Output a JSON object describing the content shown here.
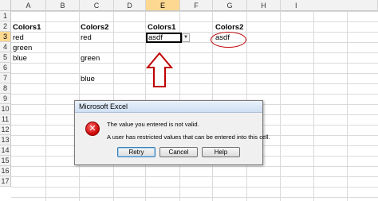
{
  "sheet": {
    "columns": [
      "A",
      "B",
      "C",
      "D",
      "E",
      "F",
      "G",
      "H",
      "I"
    ],
    "rows": [
      "1",
      "2",
      "3",
      "4",
      "5",
      "6",
      "7",
      "8",
      "9",
      "10",
      "11",
      "12",
      "13",
      "14",
      "15",
      "16",
      "17"
    ],
    "selected_column": "E",
    "selected_row": "3"
  },
  "cells": {
    "a2": "Colors1",
    "a3": "red",
    "a4": "green",
    "a5": "blue",
    "c2": "Colors2",
    "c3": "red",
    "c6": "green",
    "c8": "blue",
    "e2": "Colors1",
    "e3": "asdf",
    "g2": "Colors2",
    "g3": "asdf"
  },
  "dialog": {
    "title": "Microsoft Excel",
    "icon": "error-x-icon",
    "line1": "The value you entered is not valid.",
    "line2": "A user has restricted values that can be entered into this cell.",
    "buttons": {
      "retry": "Retry",
      "cancel": "Cancel",
      "help": "Help"
    }
  },
  "colors": {
    "selection_header": "#fcd891",
    "annotation_red": "#c00000"
  }
}
